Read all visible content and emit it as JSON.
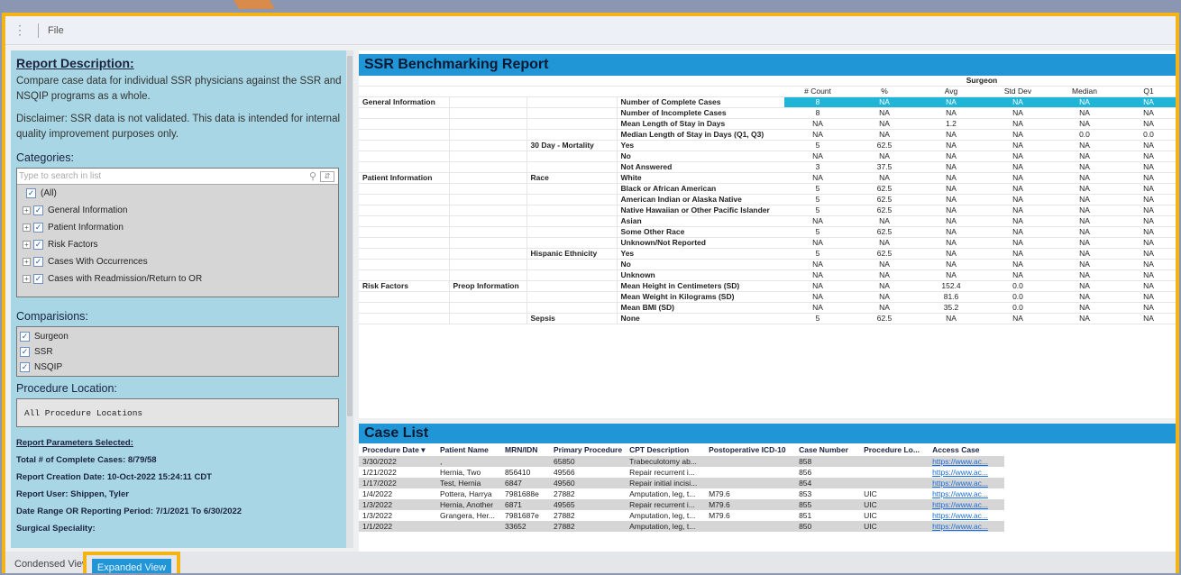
{
  "toolbar": {
    "menu_icon": "kebab-menu-icon",
    "file": "File"
  },
  "left": {
    "title": "Report Description:",
    "desc": "Compare case data for individual SSR physicians against the SSR and NSQIP programs as a whole.",
    "disclaimer": "Disclaimer: SSR data is not validated. This data is intended for internal quality improvement purposes only.",
    "categories_label": "Categories:",
    "search_placeholder": "Type to search in list",
    "categories": [
      "(All)",
      "General Information",
      "Patient Information",
      "Risk Factors",
      "Cases With Occurrences",
      "Cases with Readmission/Return to OR"
    ],
    "comparisons_label": "Comparisions:",
    "comparisons": [
      "Surgeon",
      "SSR",
      "NSQIP"
    ],
    "location_label": "Procedure Location:",
    "location_value": "All Procedure Locations",
    "params_title": "Report Parameters Selected:",
    "params": [
      "Total # of Complete Cases: 8/79/58",
      "Report Creation Date: 10-Oct-2022 15:24:11 CDT",
      "Report User: Shippen, Tyler",
      "Date Range OR Reporting Period: 7/1/2021 To 6/30/2022",
      "Surgical Speciality:"
    ]
  },
  "report": {
    "title": "SSR Benchmarking Report",
    "group_header": "Surgeon",
    "columns": [
      "# Count",
      "%",
      "Avg",
      "Std Dev",
      "Median",
      "Q1"
    ],
    "rows": [
      {
        "c1": "General Information",
        "c2": "",
        "c3": "",
        "label": "Number of Complete Cases",
        "v": [
          "8",
          "NA",
          "NA",
          "NA",
          "NA",
          "NA"
        ],
        "hi": true
      },
      {
        "c1": "",
        "c2": "",
        "c3": "",
        "label": "Number of Incomplete Cases",
        "v": [
          "8",
          "NA",
          "NA",
          "NA",
          "NA",
          "NA"
        ]
      },
      {
        "c1": "",
        "c2": "",
        "c3": "",
        "label": "Mean Length of Stay in Days",
        "v": [
          "NA",
          "NA",
          "1.2",
          "NA",
          "NA",
          "NA"
        ]
      },
      {
        "c1": "",
        "c2": "",
        "c3": "",
        "label": "Median Length of Stay in Days (Q1, Q3)",
        "v": [
          "NA",
          "NA",
          "NA",
          "NA",
          "0.0",
          "0.0"
        ]
      },
      {
        "c1": "",
        "c2": "",
        "c3": "30 Day - Mortality",
        "label": "Yes",
        "v": [
          "5",
          "62.5",
          "NA",
          "NA",
          "NA",
          "NA"
        ]
      },
      {
        "c1": "",
        "c2": "",
        "c3": "",
        "label": "No",
        "v": [
          "NA",
          "NA",
          "NA",
          "NA",
          "NA",
          "NA"
        ]
      },
      {
        "c1": "",
        "c2": "",
        "c3": "",
        "label": "Not Answered",
        "v": [
          "3",
          "37.5",
          "NA",
          "NA",
          "NA",
          "NA"
        ]
      },
      {
        "c1": "Patient Information",
        "c2": "",
        "c3": "Race",
        "label": "White",
        "v": [
          "NA",
          "NA",
          "NA",
          "NA",
          "NA",
          "NA"
        ]
      },
      {
        "c1": "",
        "c2": "",
        "c3": "",
        "label": "Black or African American",
        "v": [
          "5",
          "62.5",
          "NA",
          "NA",
          "NA",
          "NA"
        ]
      },
      {
        "c1": "",
        "c2": "",
        "c3": "",
        "label": "American Indian or Alaska Native",
        "v": [
          "5",
          "62.5",
          "NA",
          "NA",
          "NA",
          "NA"
        ]
      },
      {
        "c1": "",
        "c2": "",
        "c3": "",
        "label": "Native Hawaiian or Other Pacific Islander",
        "v": [
          "5",
          "62.5",
          "NA",
          "NA",
          "NA",
          "NA"
        ]
      },
      {
        "c1": "",
        "c2": "",
        "c3": "",
        "label": "Asian",
        "v": [
          "NA",
          "NA",
          "NA",
          "NA",
          "NA",
          "NA"
        ]
      },
      {
        "c1": "",
        "c2": "",
        "c3": "",
        "label": "Some Other Race",
        "v": [
          "5",
          "62.5",
          "NA",
          "NA",
          "NA",
          "NA"
        ]
      },
      {
        "c1": "",
        "c2": "",
        "c3": "",
        "label": "Unknown/Not Reported",
        "v": [
          "NA",
          "NA",
          "NA",
          "NA",
          "NA",
          "NA"
        ]
      },
      {
        "c1": "",
        "c2": "",
        "c3": "Hispanic Ethnicity",
        "label": "Yes",
        "v": [
          "5",
          "62.5",
          "NA",
          "NA",
          "NA",
          "NA"
        ]
      },
      {
        "c1": "",
        "c2": "",
        "c3": "",
        "label": "No",
        "v": [
          "NA",
          "NA",
          "NA",
          "NA",
          "NA",
          "NA"
        ]
      },
      {
        "c1": "",
        "c2": "",
        "c3": "",
        "label": "Unknown",
        "v": [
          "NA",
          "NA",
          "NA",
          "NA",
          "NA",
          "NA"
        ]
      },
      {
        "c1": "Risk Factors",
        "c2": "Preop Information",
        "c3": "",
        "label": "Mean Height in Centimeters (SD)",
        "v": [
          "NA",
          "NA",
          "152.4",
          "0.0",
          "NA",
          "NA"
        ]
      },
      {
        "c1": "",
        "c2": "",
        "c3": "",
        "label": "Mean Weight in Kilograms (SD)",
        "v": [
          "NA",
          "NA",
          "81.6",
          "0.0",
          "NA",
          "NA"
        ]
      },
      {
        "c1": "",
        "c2": "",
        "c3": "",
        "label": "Mean BMI (SD)",
        "v": [
          "NA",
          "NA",
          "35.2",
          "0.0",
          "NA",
          "NA"
        ]
      },
      {
        "c1": "",
        "c2": "",
        "c3": "Sepsis",
        "label": "None",
        "v": [
          "5",
          "62.5",
          "NA",
          "NA",
          "NA",
          "NA"
        ]
      }
    ]
  },
  "cases": {
    "title": "Case List",
    "sort_icon": "sort-desc-icon",
    "headers": [
      "Procedure Date",
      "Patient Name",
      "MRN/IDN",
      "Primary Procedure",
      "CPT Description",
      "Postoperative ICD-10",
      "Case Number",
      "Procedure Lo...",
      "Access Case"
    ],
    "rows": [
      [
        "3/30/2022",
        ",",
        "",
        "65850",
        "Trabeculotomy ab...",
        "",
        "858",
        "",
        "https://www.ac..."
      ],
      [
        "1/21/2022",
        "Hernia, Two",
        "856410",
        "49566",
        "Repair recurrent i...",
        "",
        "856",
        "",
        "https://www.ac..."
      ],
      [
        "1/17/2022",
        "Test, Hernia",
        "6847",
        "49560",
        "Repair initial incisi...",
        "",
        "854",
        "",
        "https://www.ac..."
      ],
      [
        "1/4/2022",
        "Pottera, Harrya",
        "7981688e",
        "27882",
        "Amputation, leg, t...",
        "M79.6",
        "853",
        "UIC",
        "https://www.ac..."
      ],
      [
        "1/3/2022",
        "Hernia, Another",
        "6871",
        "49565",
        "Repair recurrent i...",
        "M79.6",
        "855",
        "UIC",
        "https://www.ac..."
      ],
      [
        "1/3/2022",
        "Grangera, Her...",
        "7981687e",
        "27882",
        "Amputation, leg, t...",
        "M79.6",
        "851",
        "UIC",
        "https://www.ac..."
      ],
      [
        "1/1/2022",
        "",
        "33652",
        "27882",
        "Amputation, leg, t...",
        "",
        "850",
        "UIC",
        "https://www.ac..."
      ]
    ]
  },
  "tabs": {
    "condensed": "Condensed View",
    "expanded": "Expanded View"
  }
}
